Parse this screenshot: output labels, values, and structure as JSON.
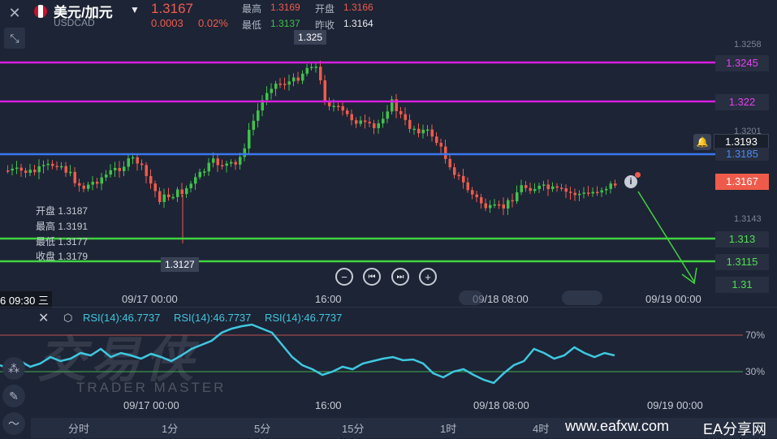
{
  "header": {
    "close_icon": "close-icon",
    "expand_icon": "collapse-icon",
    "symbol_name": "美元/加元",
    "symbol_code": "USDCAD",
    "price": "1.3167",
    "change": "0.0003",
    "change_pct": "0.02%",
    "stats": {
      "high_label": "最高",
      "high": "1.3169",
      "open_label": "开盘",
      "open": "1.3166",
      "low_label": "最低",
      "low": "1.3137",
      "prev_label": "昨收",
      "prev": "1.3164"
    }
  },
  "chart": {
    "axis_prices": [
      "1.3258",
      "1.3201",
      "1.3143"
    ],
    "high_marker": "1.325",
    "low_marker": "1.3127",
    "lines": [
      {
        "label": "1.3245",
        "color": "#d61ee0"
      },
      {
        "label": "1.322",
        "color": "#d61ee0"
      },
      {
        "label": "1.3185",
        "color": "#3a78f0"
      },
      {
        "label": "1.313",
        "color": "#3fd340"
      },
      {
        "label": "1.3115",
        "color": "#3fd340"
      },
      {
        "label": "1.31",
        "color": "#3fd340"
      }
    ],
    "current_price_tag": "1.3193",
    "last_price_tag": "1.3167",
    "ohlc": {
      "open_label": "开盘",
      "open": "1.3187",
      "high_label": "最高",
      "high": "1.3191",
      "low_label": "最低",
      "low": "1.3177",
      "close_label": "收盘",
      "close": "1.3179"
    },
    "time_labels": [
      "09/17 00:00",
      "16:00",
      "09/18 08:00",
      "09/19 00:00"
    ],
    "crosshair_time": "6 09:30 三"
  },
  "nav_controls": {
    "zoom_out": "−",
    "prev": "⏮",
    "next": "⏭",
    "zoom_in": "+"
  },
  "rsi": {
    "labels": [
      "RSI(14):46.7737",
      "RSI(14):46.7737",
      "RSI(14):46.7737"
    ],
    "levels": [
      "70%",
      "30%"
    ],
    "time_labels": [
      "09/17 00:00",
      "16:00",
      "09/18 08:00",
      "09/19 00:00"
    ]
  },
  "watermark": {
    "brand": "交易侠",
    "sub": "TRADER MASTER"
  },
  "timeframes": [
    "分时",
    "1分",
    "5分",
    "15分",
    "1时",
    "4时"
  ],
  "site": {
    "url": "www.eafxw.com",
    "name": "EA分享网"
  },
  "colors": {
    "bg": "#1d2435",
    "up": "#3fc24a",
    "down": "#ef5b4b",
    "rsi": "#3ec8e0"
  }
}
